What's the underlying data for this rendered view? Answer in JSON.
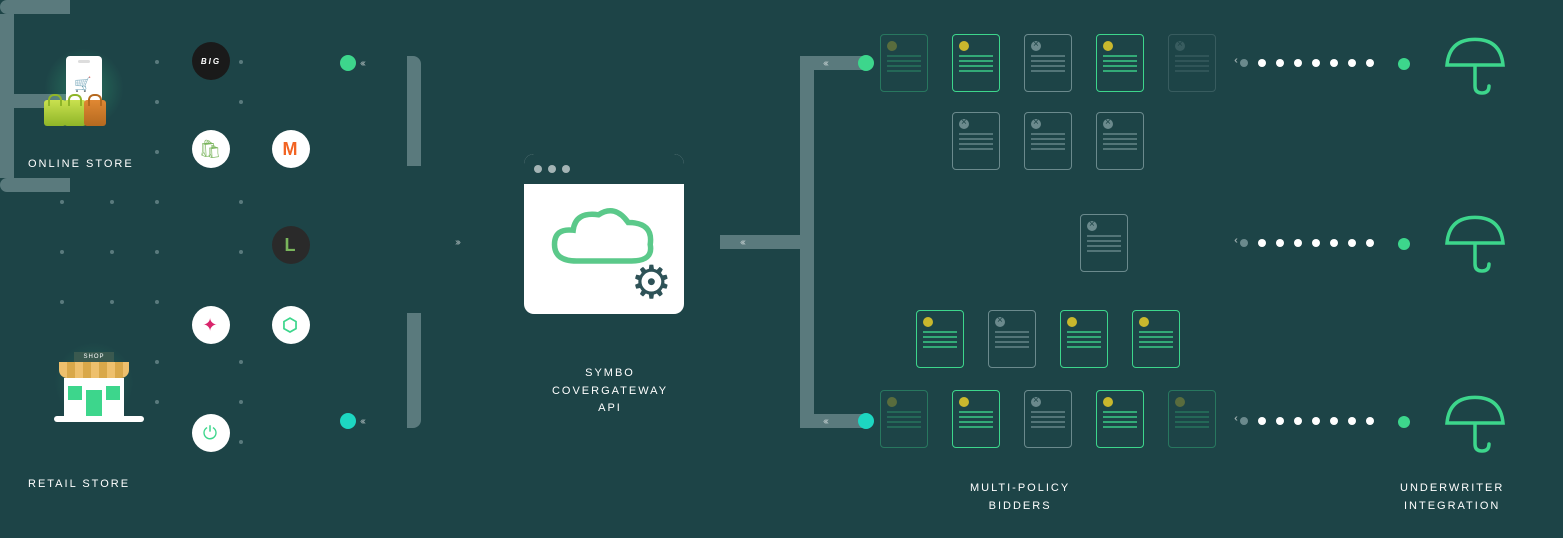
{
  "stores": {
    "online_label": "ONLINE STORE",
    "retail_label": "RETAIL STORE",
    "shop_sign": "SHOP"
  },
  "platforms": {
    "big": "BIG",
    "shopify": "🛍",
    "magento": "M",
    "leaf": "L",
    "presta": "✦",
    "chain": "⬡",
    "plug": "⏻"
  },
  "center": {
    "line1": "SYMBO",
    "line2": "COVERGATEWAY",
    "line3": "API"
  },
  "bidders": {
    "label1": "MULTI-POLICY",
    "label2": "BIDDERS"
  },
  "underwriter": {
    "label1": "UNDERWRITER",
    "label2": "INTEGRATION"
  },
  "colors": {
    "bg": "#1d4447",
    "accent": "#3dd68c",
    "pipe": "#5a7a7d",
    "gold": "#c9b82d"
  },
  "chev": {
    "right": "›››",
    "left": "‹‹‹"
  }
}
